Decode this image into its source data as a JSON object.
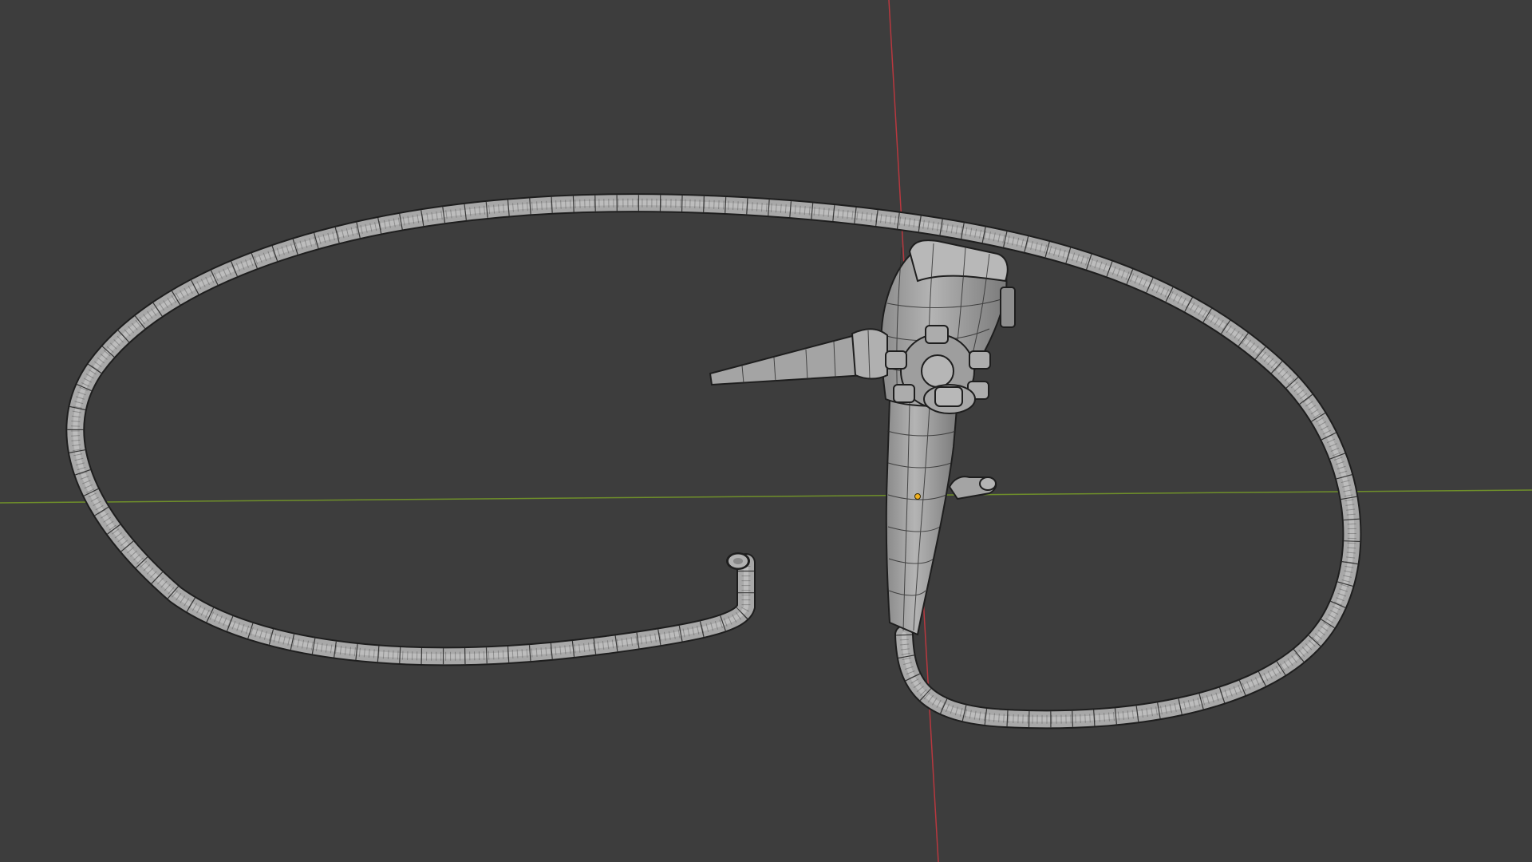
{
  "viewport": {
    "background_color": "#3d3d3d",
    "x_axis_color": "#7a9a2a",
    "y_axis_color": "#b8383f",
    "mesh_color": "#a9a9a9",
    "mesh_shade_color": "#7f7f7f",
    "wire_color": "#1e1e1e",
    "origin_color": "#f0b020"
  },
  "scene": {
    "object_name": "endoscope-model",
    "display_mode": "solid-wireframe-overlay"
  }
}
